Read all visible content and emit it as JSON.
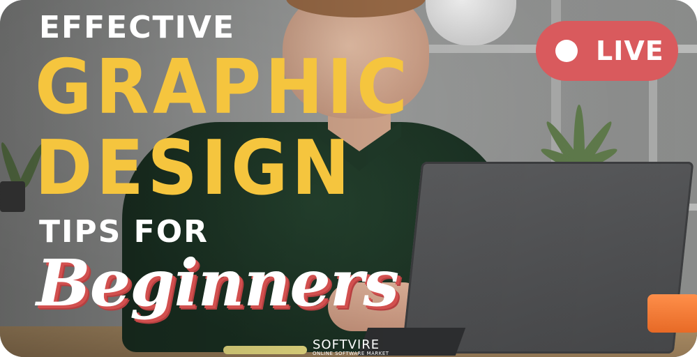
{
  "headline": {
    "line1": "EFFECTIVE",
    "line2": "GRAPHIC",
    "line3": "DESIGN",
    "line4": "TIPS FOR",
    "line5": "Beginners"
  },
  "badge": {
    "label": "LIVE",
    "icon": "record-dot-icon",
    "color": "#d95a5d"
  },
  "watermark": {
    "brand": "SOFTVIRE",
    "tagline": "ONLINE SOFTWARE MARKET"
  },
  "colors": {
    "accent_yellow": "#f5c53e",
    "script_shadow": "#d2504f"
  }
}
